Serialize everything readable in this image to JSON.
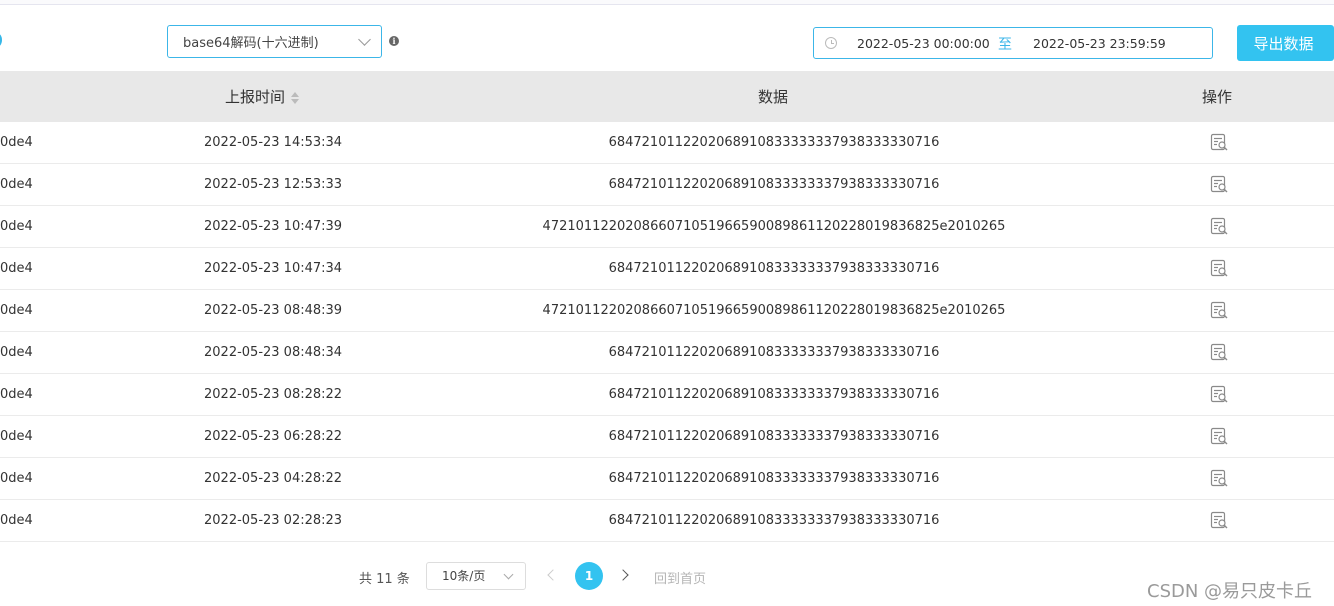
{
  "filters": {
    "decode_select": "base64解码(十六进制)",
    "date_start": "2022-05-23 00:00:00",
    "date_separator": "至",
    "date_end": "2022-05-23 23:59:59",
    "export_label": "导出数据"
  },
  "table": {
    "headers": {
      "time": "上报时间",
      "data": "数据",
      "operation": "操作"
    },
    "rows": [
      {
        "id": "0de4",
        "time": "2022-05-23 14:53:34",
        "data": "6847210112202068910833333337938333330716"
      },
      {
        "id": "0de4",
        "time": "2022-05-23 12:53:33",
        "data": "6847210112202068910833333337938333330716"
      },
      {
        "id": "0de4",
        "time": "2022-05-23 10:47:39",
        "data": "472101122020866071051966590089861120228019836825e2010265"
      },
      {
        "id": "0de4",
        "time": "2022-05-23 10:47:34",
        "data": "6847210112202068910833333337938333330716"
      },
      {
        "id": "0de4",
        "time": "2022-05-23 08:48:39",
        "data": "472101122020866071051966590089861120228019836825e2010265"
      },
      {
        "id": "0de4",
        "time": "2022-05-23 08:48:34",
        "data": "6847210112202068910833333337938333330716"
      },
      {
        "id": "0de4",
        "time": "2022-05-23 08:28:22",
        "data": "6847210112202068910833333337938333330716"
      },
      {
        "id": "0de4",
        "time": "2022-05-23 06:28:22",
        "data": "6847210112202068910833333337938333330716"
      },
      {
        "id": "0de4",
        "time": "2022-05-23 04:28:22",
        "data": "6847210112202068910833333337938333330716"
      },
      {
        "id": "0de4",
        "time": "2022-05-23 02:28:23",
        "data": "6847210112202068910833333337938333330716"
      }
    ]
  },
  "pagination": {
    "total": "共 11 条",
    "page_size": "10条/页",
    "current_page": "1",
    "home_label": "回到首页"
  },
  "watermark": "CSDN @易只皮卡丘",
  "colors": {
    "accent": "#33c3f0",
    "header_bg": "#e8e8e8"
  }
}
